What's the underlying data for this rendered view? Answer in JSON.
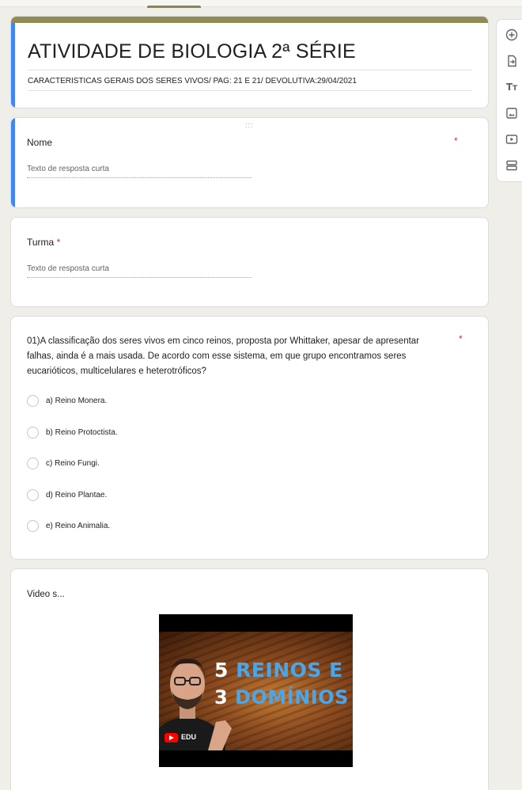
{
  "form": {
    "title": "ATIVIDADE DE BIOLOGIA 2ª SÉRIE",
    "description": "CARACTERISTICAS GERAIS DOS SERES VIVOS/ PAG: 21 E 21/ DEVOLUTIVA:29/04/2021"
  },
  "questions": [
    {
      "label": "Nome",
      "required_mark": "*",
      "answer_placeholder": "Texto de resposta curta",
      "drag_handle": ":::"
    },
    {
      "label": "Turma",
      "required_mark": "*",
      "answer_placeholder": "Texto de resposta curta"
    },
    {
      "text": "01)A classificação dos seres vivos em cinco reinos, proposta por Whittaker, apesar de apresentar falhas, ainda é a mais usada. De acordo com esse sistema, em que grupo encontramos seres eucarióticos, multicelulares e heterotróficos?",
      "required_mark": "*",
      "options": [
        "a) Reino Monera.",
        "b) Reino Protoctista.",
        "c) Reino Fungi.",
        "d) Reino Plantae.",
        "e) Reino Animalia."
      ]
    }
  ],
  "video": {
    "title": "Video s...",
    "thumbnail": {
      "line1_num": "5",
      "line1_word": "REINOS E",
      "line2_num": "3",
      "line2_word": "DOMÍNIOS",
      "channel_label": "EDU"
    }
  },
  "side_toolbar": [
    {
      "icon": "add-question-icon",
      "glyph": "⊕"
    },
    {
      "icon": "import-questions-icon",
      "glyph": "⎘"
    },
    {
      "icon": "add-title-icon",
      "glyph": "Tт"
    },
    {
      "icon": "add-image-icon",
      "glyph": "▣"
    },
    {
      "icon": "add-video-icon",
      "glyph": "▶"
    },
    {
      "icon": "add-section-icon",
      "glyph": "☰"
    }
  ],
  "colors": {
    "theme": "#918c55",
    "focus": "#4285f4",
    "required": "#d93025",
    "background": "#efeee9"
  }
}
